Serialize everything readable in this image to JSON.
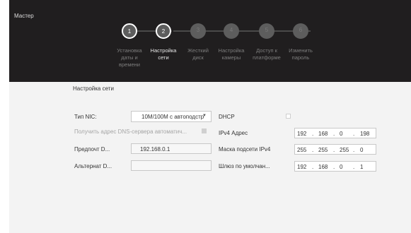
{
  "window": {
    "title": "Мастер"
  },
  "wizard": {
    "steps": [
      {
        "number": "1",
        "label_lines": [
          "Установка",
          "даты и",
          "времени"
        ]
      },
      {
        "number": "2",
        "label_lines": [
          "Настройка",
          "сети"
        ]
      },
      {
        "number": "3",
        "label_lines": [
          "Жесткий",
          "диск"
        ]
      },
      {
        "number": "4",
        "label_lines": [
          "Настройка",
          "камеры"
        ]
      },
      {
        "number": "5",
        "label_lines": [
          "Доступ к",
          "платформе"
        ]
      },
      {
        "number": "6",
        "label_lines": [
          "Изменить",
          "пароль"
        ]
      }
    ],
    "current_step": 2
  },
  "network": {
    "section_title": "Настройка сети",
    "nic_type": {
      "label": "Тип NIC:",
      "value": "10M/100M с автоподстр"
    },
    "auto_dns": {
      "label": "Получить адрес DNS-сервера автоматич...",
      "checked": false
    },
    "preferred_dns": {
      "label": "Предпочт D...",
      "value": "192.168.0.1"
    },
    "alternate_dns": {
      "label": "Альтернат D...",
      "value": ""
    },
    "dhcp": {
      "label": "DHCP",
      "checked": false
    },
    "ipv4_address": {
      "label": "IPv4 Адрес",
      "octets": [
        "192",
        "168",
        "0",
        "198"
      ]
    },
    "subnet_mask": {
      "label": "Маска подсети IPv4",
      "octets": [
        "255",
        "255",
        "255",
        "0"
      ]
    },
    "gateway": {
      "label": "Шлюз по умолчан...",
      "octets": [
        "192",
        "168",
        "0",
        "1"
      ]
    }
  },
  "colors": {
    "header_bg": "#201e1f",
    "content_bg": "#f3f3f3",
    "step_circle": "#5d5d5d",
    "active_ring": "#ffffff"
  }
}
